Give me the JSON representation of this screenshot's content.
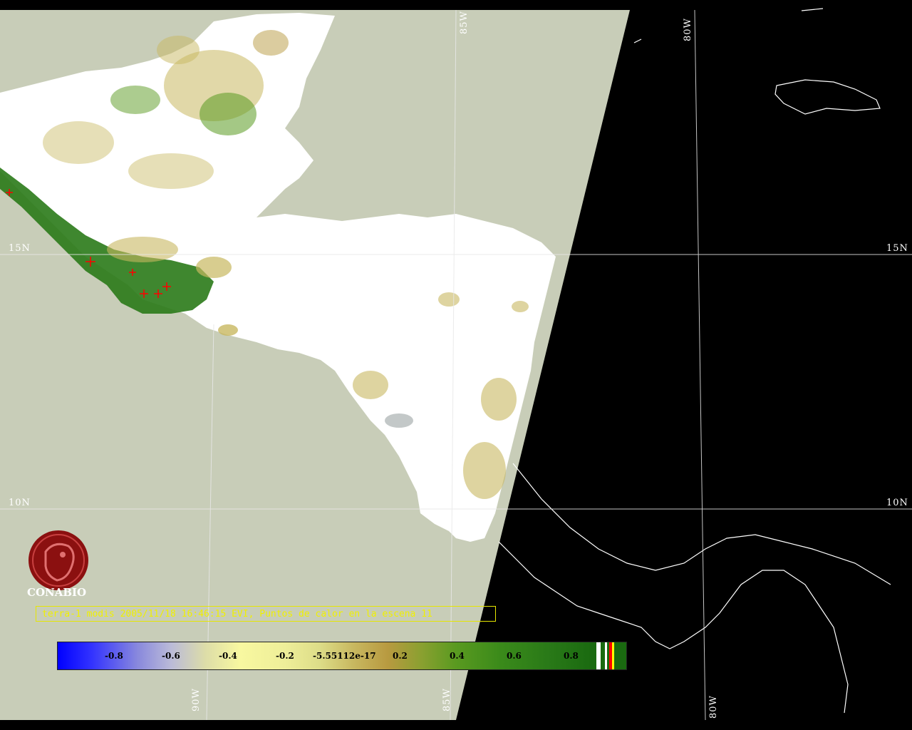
{
  "map": {
    "grid_labels": {
      "lat_15_left": "15N",
      "lat_15_right": "15N",
      "lat_10_left": "10N",
      "lat_10_right": "10N",
      "lon_85_top": "85W",
      "lon_80_top": "80W",
      "lon_90_bottom": "90W",
      "lon_85_bottom": "85W",
      "lon_80_bottom": "80W"
    },
    "logo_text": "CONABIO",
    "caption": "terra-1 modis 2005/11/18 16:46:15 EVI, Puntos de calor en la escena 11",
    "colorbar_labels": [
      "-0.8",
      "-0.6",
      "-0.4",
      "-0.2",
      "-5.55112e-17",
      "0.2",
      "0.4",
      "0.6",
      "0.8"
    ],
    "colors": {
      "ocean_swath": "#c8cdb8",
      "cloud": "#ffffff",
      "no_data": "#000000",
      "vegetation_dark": "#2a7a18",
      "vegetation_light": "#c8b860",
      "hotspot": "#ff0000",
      "caption_text": "#f0f000",
      "logo": "#8b1010"
    }
  }
}
